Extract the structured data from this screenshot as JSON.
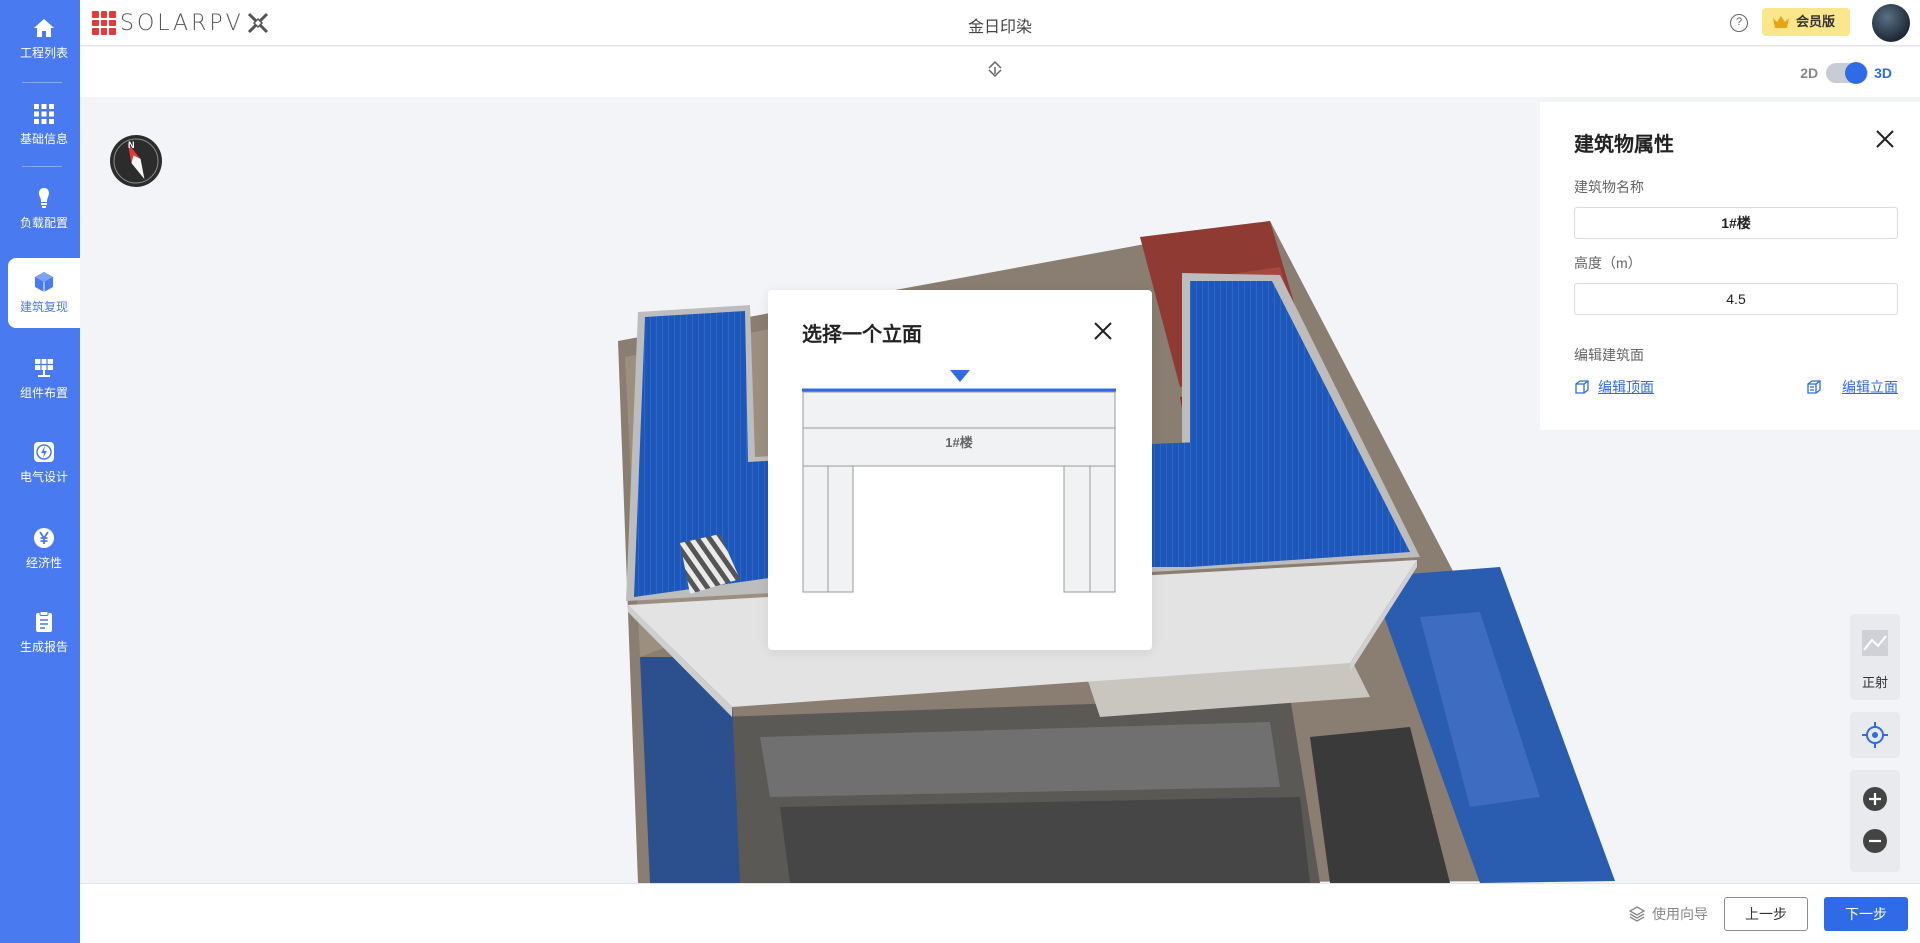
{
  "sidebar": {
    "items": [
      {
        "label": "工程列表",
        "icon": "home-icon"
      },
      {
        "label": "基础信息",
        "icon": "grid-icon"
      },
      {
        "label": "负载配置",
        "icon": "bulb-icon"
      },
      {
        "label": "建筑复现",
        "icon": "cube-icon"
      },
      {
        "label": "组件布置",
        "icon": "solar-panel-icon"
      },
      {
        "label": "电气设计",
        "icon": "lightning-icon"
      },
      {
        "label": "经济性",
        "icon": "yen-icon"
      },
      {
        "label": "生成报告",
        "icon": "report-icon"
      }
    ],
    "active_index": 3
  },
  "header": {
    "logo_text": "SOLARPV",
    "project_title": "金日印染",
    "help_symbol": "?",
    "vip_label": "会员版"
  },
  "view_toggle": {
    "label_2d": "2D",
    "label_3d": "3D",
    "selected": "3D"
  },
  "panel": {
    "title": "建筑物属性",
    "name_label": "建筑物名称",
    "name_value": "1#楼",
    "height_label": "高度（m）",
    "height_value": "4.5",
    "edit_section_label": "编辑建筑面",
    "edit_top_link": "编辑顶面",
    "edit_facade_link": "编辑立面"
  },
  "dialog": {
    "title": "选择一个立面",
    "building_label": "1#楼"
  },
  "map_controls": {
    "ortho_label": "正射"
  },
  "footer": {
    "guide_label": "使用向导",
    "prev_label": "上一步",
    "next_label": "下一步"
  },
  "colors": {
    "accent": "#2f6be6",
    "sidebar": "#4a7af0",
    "roof_blue": "#1f57b8",
    "vip": "#fbe68c"
  }
}
